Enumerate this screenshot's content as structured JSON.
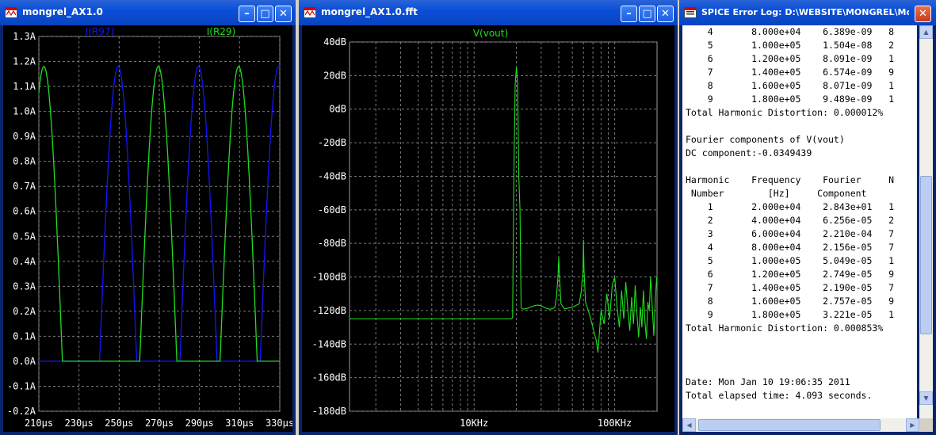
{
  "windows": {
    "transient": {
      "title": "mongrel_AX1.0",
      "traces": [
        {
          "name": "I(R97)",
          "color": "#1414ff"
        },
        {
          "name": "I(R29)",
          "color": "#1ee01e"
        }
      ],
      "y_ticks": [
        "1.3A",
        "1.2A",
        "1.1A",
        "1.0A",
        "0.9A",
        "0.8A",
        "0.7A",
        "0.6A",
        "0.5A",
        "0.4A",
        "0.3A",
        "0.2A",
        "0.1A",
        "0.0A",
        "-0.1A",
        "-0.2A"
      ],
      "x_ticks": [
        "210µs",
        "230µs",
        "250µs",
        "270µs",
        "290µs",
        "310µs",
        "330µs"
      ]
    },
    "fft": {
      "title": "mongrel_AX1.0.fft",
      "traces": [
        {
          "name": "V(vout)",
          "color": "#1ee01e"
        }
      ],
      "y_ticks": [
        "40dB",
        "20dB",
        "0dB",
        "-20dB",
        "-40dB",
        "-60dB",
        "-80dB",
        "-100dB",
        "-120dB",
        "-140dB",
        "-160dB",
        "-180dB"
      ],
      "x_ticks": [
        "10KHz",
        "100KHz"
      ]
    },
    "log": {
      "title": "SPICE Error Log: D:\\WEBSITE\\MONGREL\\Mongrel_...",
      "lines": [
        "    4       8.000e+04    6.389e-09   8",
        "    5       1.000e+05    1.504e-08   2",
        "    6       1.200e+05    8.091e-09   1",
        "    7       1.400e+05    6.574e-09   9",
        "    8       1.600e+05    8.071e-09   1",
        "    9       1.800e+05    9.489e-09   1",
        "Total Harmonic Distortion: 0.000012%",
        "",
        "Fourier components of V(vout)",
        "DC component:-0.0349439",
        "",
        "Harmonic    Frequency    Fourier     N",
        " Number        [Hz]     Component",
        "    1       2.000e+04    2.843e+01   1",
        "    2       4.000e+04    6.256e-05   2",
        "    3       6.000e+04    2.210e-04   7",
        "    4       8.000e+04    2.156e-05   7",
        "    5       1.000e+05    5.049e-05   1",
        "    6       1.200e+05    2.749e-05   9",
        "    7       1.400e+05    2.190e-05   7",
        "    8       1.600e+05    2.757e-05   9",
        "    9       1.800e+05    3.221e-05   1",
        "Total Harmonic Distortion: 0.000853%",
        "",
        "",
        "",
        "Date: Mon Jan 10 19:06:35 2011",
        "Total elapsed time: 4.093 seconds."
      ]
    }
  },
  "chart_data": [
    {
      "type": "line",
      "x_unit": "µs",
      "xlim": [
        210,
        330
      ],
      "ylim": [
        -0.2,
        1.3
      ],
      "grid": true,
      "series": [
        {
          "name": "I(R97)",
          "x": [
            210,
            219,
            228,
            237,
            246,
            255,
            264,
            273,
            282,
            291,
            300,
            309,
            318,
            327,
            330
          ],
          "values": [
            0,
            0,
            0,
            0,
            0.76,
            1.09,
            0.06,
            0,
            0,
            1.18,
            0.3,
            0,
            0,
            0,
            0.63
          ]
        },
        {
          "name": "I(R29)",
          "x": [
            210,
            212,
            217,
            222,
            227,
            232,
            237,
            246,
            255,
            264,
            273,
            282,
            291,
            300,
            309,
            318,
            327
          ],
          "values": [
            1.1,
            1.18,
            1.03,
            0.43,
            0.01,
            0,
            0,
            0,
            0.65,
            1.12,
            0.03,
            0,
            0,
            0.95,
            1.0,
            0,
            0
          ]
        }
      ]
    },
    {
      "type": "line",
      "x_scale": "log",
      "x_unit": "Hz",
      "ylim": [
        -180,
        40
      ],
      "grid": true,
      "series": [
        {
          "name": "V(vout)",
          "x": [
            2000,
            10000,
            18000,
            20000,
            22000,
            40000,
            60000,
            80000,
            100000,
            120000,
            140000,
            160000,
            180000
          ],
          "values": [
            -126,
            -125,
            -125,
            25,
            -118,
            -88,
            -78,
            -140,
            -100,
            -125,
            -105,
            -130,
            -100
          ]
        }
      ]
    }
  ]
}
